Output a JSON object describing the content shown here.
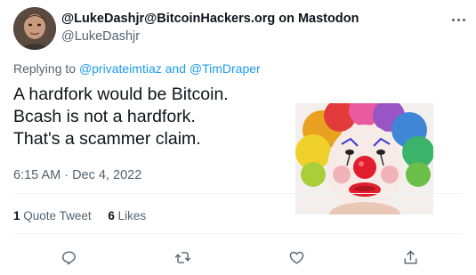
{
  "tweet": {
    "author": {
      "display_name": "@LukeDashjr@BitcoinHackers.org on Mastodon",
      "handle": "@LukeDashjr"
    },
    "replying": {
      "prefix": "Replying to",
      "mention1": "@privateimtiaz",
      "and_text": "and",
      "mention2": "@TimDraper"
    },
    "text_lines": [
      "A hardfork would be Bitcoin.",
      "Bcash is not a hardfork.",
      "That's a scammer claim."
    ],
    "timestamp": "6:15 AM · Dec 4, 2022",
    "stats": {
      "quote_count": "1",
      "quote_label": "Quote Tweet",
      "like_count": "6",
      "like_label": "Likes"
    },
    "actions": {
      "reply_icon": "reply-icon",
      "retweet_icon": "retweet-icon",
      "like_icon": "heart-icon",
      "share_icon": "share-icon"
    }
  },
  "colors": {
    "link": "#1d9bf0",
    "text": "#0f1419",
    "muted": "#536471",
    "divider": "#eff3f4"
  }
}
